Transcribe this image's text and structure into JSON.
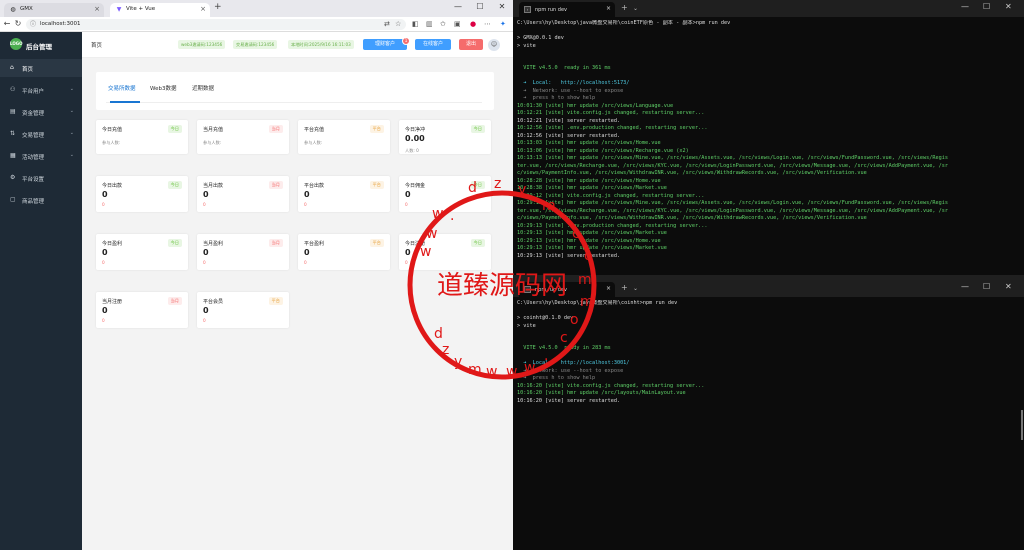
{
  "browser": {
    "tabs": [
      {
        "label": "GMX",
        "icon": "globe-icon"
      },
      {
        "label": "Vite + Vue",
        "icon": "vite-icon"
      }
    ],
    "new_tab": "+",
    "url": "localhost:3001",
    "window_controls": {
      "minimize": "—",
      "maximize": "☐",
      "close": "✕"
    }
  },
  "app": {
    "logo_mark": "LOGO",
    "title": "后台管理",
    "sidebar": [
      {
        "label": "首页",
        "icon": "home-icon",
        "active": true
      },
      {
        "label": "平台用户",
        "icon": "user-icon",
        "has_children": true
      },
      {
        "label": "资金管理",
        "icon": "wallet-icon",
        "has_children": true
      },
      {
        "label": "交易管理",
        "icon": "trade-icon",
        "has_children": true
      },
      {
        "label": "活动管理",
        "icon": "gift-icon",
        "has_children": true
      },
      {
        "label": "平台设置",
        "icon": "gear-icon"
      },
      {
        "label": "商品管理",
        "icon": "box-icon"
      }
    ],
    "breadcrumb": "首页",
    "header_tags": [
      "web3邀请码:123456",
      "交易邀请码:123456",
      "本地时间:2025/9/16 16:11:03"
    ],
    "buttons": {
      "trade_customers": "理财客户",
      "trade_badge": "1",
      "online_customers": "在线客户",
      "logout": "退出"
    },
    "content_tabs": [
      "交易所数据",
      "Web3数据",
      "近期数据"
    ],
    "cards": [
      {
        "title": "今日充值",
        "tag": "今日",
        "tag_color": "green",
        "sub": "参与人数:"
      },
      {
        "title": "当月充值",
        "tag": "当月",
        "tag_color": "red",
        "sub": "参与人数:"
      },
      {
        "title": "平台充值",
        "tag": "平台",
        "tag_color": "orange",
        "sub": "参与人数:"
      },
      {
        "title": "今日净冲",
        "tag": "今日",
        "tag_color": "green",
        "value": "0.00",
        "sub": "人数: 0"
      },
      {
        "title": "今日出款",
        "tag": "今日",
        "tag_color": "green",
        "value": "0",
        "note": "0"
      },
      {
        "title": "当月出款",
        "tag": "当月",
        "tag_color": "red",
        "value": "0",
        "note": "0"
      },
      {
        "title": "平台出款",
        "tag": "平台",
        "tag_color": "orange",
        "value": "0",
        "note": "0"
      },
      {
        "title": "今日佣金",
        "tag": "今日",
        "tag_color": "green",
        "value": "0",
        "note": "0"
      },
      {
        "title": "今日盈利",
        "tag": "今日",
        "tag_color": "green",
        "value": "0",
        "note": "0"
      },
      {
        "title": "当月盈利",
        "tag": "当月",
        "tag_color": "red",
        "value": "0",
        "note": "0"
      },
      {
        "title": "平台盈利",
        "tag": "平台",
        "tag_color": "orange",
        "value": "0",
        "note": "0"
      },
      {
        "title": "今日注册",
        "tag": "今日",
        "tag_color": "green",
        "value": "0",
        "note": "0"
      },
      {
        "title": "当月注册",
        "tag": "当月",
        "tag_color": "red",
        "value": "0",
        "note": "0"
      },
      {
        "title": "平台会员",
        "tag": "平台",
        "tag_color": "orange",
        "value": "0",
        "note": "0"
      }
    ]
  },
  "terminal_top": {
    "tab": "npm run dev",
    "lines": [
      {
        "t": "C:\\Users\\hy\\Desktop\\java微盘交易所\\coinETF原色 - 副本 - 副本>npm run dev",
        "c": "c-w"
      },
      {
        "t": "",
        "c": ""
      },
      {
        "t": "> GMX@0.0.1 dev",
        "c": "c-w"
      },
      {
        "t": "> vite",
        "c": "c-w"
      },
      {
        "t": "",
        "c": ""
      },
      {
        "t": "",
        "c": ""
      },
      {
        "t": "  VITE v4.5.0  ready in 361 ms",
        "c": "c-g"
      },
      {
        "t": "",
        "c": ""
      },
      {
        "t": "  ➜  Local:   http://localhost:5173/",
        "c": "c-c"
      },
      {
        "t": "  ➜  Network: use --host to expose",
        "c": "c-d"
      },
      {
        "t": "  ➜  press h to show help",
        "c": "c-d"
      },
      {
        "t": "10:01:30 [vite] hmr update /src/views/Language.vue",
        "c": "c-g"
      },
      {
        "t": "10:12:21 [vite] vite.config.js changed, restarting server...",
        "c": "c-g"
      },
      {
        "t": "10:12:21 [vite] server restarted.",
        "c": "c-w"
      },
      {
        "t": "10:12:56 [vite] .env.production changed, restarting server...",
        "c": "c-g"
      },
      {
        "t": "10:12:56 [vite] server restarted.",
        "c": "c-w"
      },
      {
        "t": "10:13:03 [vite] hmr update /src/views/Home.vue",
        "c": "c-g"
      },
      {
        "t": "10:13:06 [vite] hmr update /src/views/Recharge.vue (x2)",
        "c": "c-g"
      },
      {
        "t": "10:13:13 [vite] hmr update /src/views/Mine.vue, /src/views/Assets.vue, /src/views/Login.vue, /src/views/FundPassword.vue, /src/views/Regis",
        "c": "c-g"
      },
      {
        "t": "ter.vue, /src/views/Recharge.vue, /src/views/KYC.vue, /src/views/LoginPassword.vue, /src/views/Message.vue, /src/views/AddPayment.vue, /sr",
        "c": "c-g"
      },
      {
        "t": "c/views/PaymentInfo.vue, /src/views/WithdrawINR.vue, /src/views/WithdrawRecords.vue, /src/views/Verification.vue",
        "c": "c-g"
      },
      {
        "t": "10:28:28 [vite] hmr update /src/views/Home.vue",
        "c": "c-g"
      },
      {
        "t": "10:28:38 [vite] hmr update /src/views/Market.vue",
        "c": "c-g"
      },
      {
        "t": "10:29:12 [vite] vite.config.js changed, restarting server...",
        "c": "c-g"
      },
      {
        "t": "10:29:13 [vite] hmr update /src/views/Mine.vue, /src/views/Assets.vue, /src/views/Login.vue, /src/views/FundPassword.vue, /src/views/Regis",
        "c": "c-g"
      },
      {
        "t": "ter.vue, /src/views/Recharge.vue, /src/views/KYC.vue, /src/views/LoginPassword.vue, /src/views/Message.vue, /src/views/AddPayment.vue, /sr",
        "c": "c-g"
      },
      {
        "t": "c/views/PaymentInfo.vue, /src/views/WithdrawINR.vue, /src/views/WithdrawRecords.vue, /src/views/Verification.vue",
        "c": "c-g"
      },
      {
        "t": "10:29:13 [vite] .env.production changed, restarting server...",
        "c": "c-g"
      },
      {
        "t": "10:29:13 [vite] hmr update /src/views/Market.vue",
        "c": "c-g"
      },
      {
        "t": "10:29:13 [vite] hmr update /src/views/Home.vue",
        "c": "c-g"
      },
      {
        "t": "10:29:13 [vite] hmr update /src/views/Market.vue",
        "c": "c-g"
      },
      {
        "t": "10:29:13 [vite] server restarted.",
        "c": "c-w"
      }
    ]
  },
  "terminal_bottom": {
    "tab": "npm run dev",
    "lines": [
      {
        "t": "C:\\Users\\hy\\Desktop\\java微盘交易所\\coinht>npm run dev",
        "c": "c-w"
      },
      {
        "t": "",
        "c": ""
      },
      {
        "t": "> coinht@0.1.0 dev",
        "c": "c-w"
      },
      {
        "t": "> vite",
        "c": "c-w"
      },
      {
        "t": "",
        "c": ""
      },
      {
        "t": "",
        "c": ""
      },
      {
        "t": "  VITE v4.5.0  ready in 283 ms",
        "c": "c-g"
      },
      {
        "t": "",
        "c": ""
      },
      {
        "t": "  ➜  Local:   http://localhost:3001/",
        "c": "c-c"
      },
      {
        "t": "  ➜  Network: use --host to expose",
        "c": "c-d"
      },
      {
        "t": "  ➜  press h to show help",
        "c": "c-d"
      },
      {
        "t": "10:16:20 [vite] vite.config.js changed, restarting server...",
        "c": "c-g"
      },
      {
        "t": "10:16:20 [vite] hmr update /src/layouts/MainLayout.vue",
        "c": "c-g"
      },
      {
        "t": "10:16:20 [vite] server restarted.",
        "c": "c-w"
      }
    ]
  },
  "watermark": {
    "text": "道臻源码网",
    "url_chars": [
      "d",
      "z",
      "y",
      "m",
      "w",
      "w",
      "w",
      ".",
      "c",
      "o",
      "m"
    ],
    "color": "#e01818"
  }
}
